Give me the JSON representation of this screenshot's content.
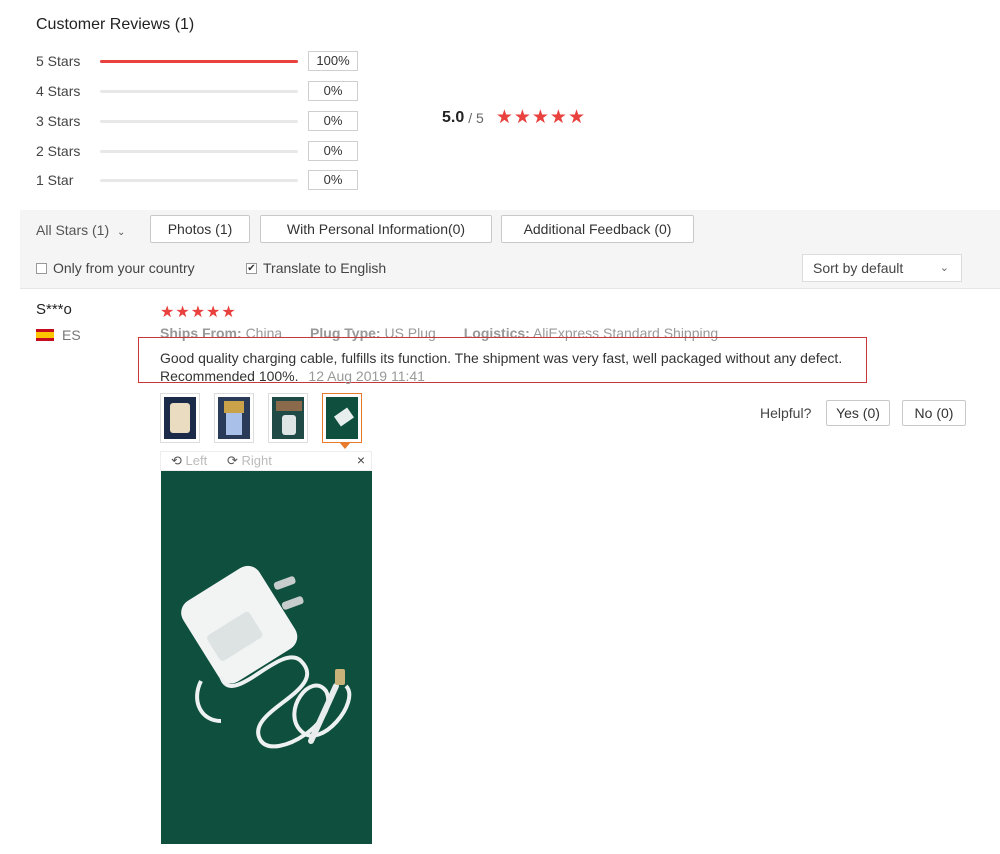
{
  "header": {
    "title": "Customer Reviews (1)"
  },
  "histogram": [
    {
      "label": "5 Stars",
      "percent": "100%",
      "fill": 1.0
    },
    {
      "label": "4 Stars",
      "percent": "0%",
      "fill": 0
    },
    {
      "label": "3 Stars",
      "percent": "0%",
      "fill": 0
    },
    {
      "label": "2 Stars",
      "percent": "0%",
      "fill": 0
    },
    {
      "label": "1 Star",
      "percent": "0%",
      "fill": 0
    }
  ],
  "average": {
    "score": "5.0",
    "out_of": "/ 5",
    "stars": "★★★★★",
    "star_count": 5
  },
  "filters": {
    "all_stars": "All Stars (1)",
    "photos": "Photos (1)",
    "personal_info": "With Personal Information(0)",
    "additional_feedback": "Additional Feedback (0)",
    "only_country": "Only from your country",
    "only_country_checked": false,
    "translate": "Translate to English",
    "translate_checked": true,
    "sort": "Sort by default"
  },
  "review": {
    "user": "S***o",
    "country_code": "ES",
    "stars": "★★★★★",
    "ships_from_label": "Ships From:",
    "ships_from_value": "China",
    "plug_type_label": "Plug Type:",
    "plug_type_value": "US Plug",
    "logistics_label": "Logistics:",
    "logistics_value": "AliExpress Standard Shipping",
    "text": "Good quality charging cable, fulfills its function. The shipment was very fast, well packaged without any defect. Recommended 100%.",
    "date": "12 Aug 2019 11:41",
    "viewer_left": "Left",
    "viewer_right": "Right",
    "viewer_close": "×",
    "helpful_label": "Helpful?",
    "yes": "Yes (0)",
    "no": "No (0)"
  },
  "colors": {
    "accent": "#e8413e",
    "highlight_box": "#c8383a",
    "thumb_active": "#e87a2b"
  },
  "icons": {
    "rotate_left": "rotate-left-icon",
    "rotate_right": "rotate-right-icon",
    "close": "close-icon",
    "caret": "chevron-down-icon"
  }
}
